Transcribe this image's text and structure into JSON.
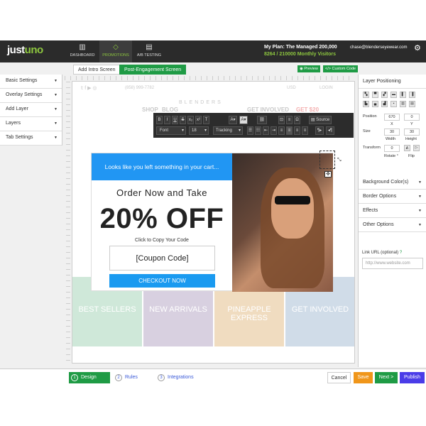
{
  "brand": {
    "logo_prefix": "just",
    "logo_suffix": "uno"
  },
  "nav": [
    {
      "label": "DASHBOARD",
      "icon": "bar-chart-icon"
    },
    {
      "label": "PROMOTIONS",
      "icon": "tag-icon"
    },
    {
      "label": "A/B TESTING",
      "icon": "ab-icon"
    }
  ],
  "plan": {
    "title": "My Plan: The Managed 200,000",
    "sub": "8264 / 210000 Monthly Visitors"
  },
  "user": {
    "email": "chase@blenderseyewear.com"
  },
  "left_menu": [
    "Basic Settings",
    "Overlay Settings",
    "Add Layer",
    "Layers",
    "Tab Settings"
  ],
  "tabs": [
    "Add Intro Screen",
    "Post-Engagement Screen"
  ],
  "canvas_buttons": {
    "preview": "Preview",
    "custom_code": "</> Custom Code"
  },
  "site": {
    "phone": "(858) 999-7782",
    "brand": "BLENDERS",
    "usd": "USD",
    "login": "LOGIN",
    "shop": "SHOP",
    "blog": "BLOG",
    "get_involved": "GET INVOLVED",
    "get_price": "GET $20",
    "tiles": [
      "BEST SELLERS",
      "NEW ARRIVALS",
      "PINEAPPLE EXPRESS",
      "GET INVOLVED"
    ]
  },
  "toolbar": {
    "source": "Source",
    "font": "Font",
    "size": "18",
    "tracking": "Tracking"
  },
  "popup": {
    "banner": "Looks like you left something in your cart...",
    "heading": "Order Now and Take",
    "discount": "20% OFF",
    "copy_hint": "Click to Copy Your Code",
    "coupon": "[Coupon Code]",
    "cta": "CHECKOUT NOW"
  },
  "right_panel": {
    "title": "Layer Positioning",
    "position": "Position",
    "x_val": "670",
    "y_val": "0",
    "x": "X",
    "y": "Y",
    "size": "Size",
    "w_val": "30",
    "h_val": "30",
    "width": "Width",
    "height": "Height",
    "transform": "Transform",
    "rotate_val": "0",
    "rotate": "Rotate °",
    "flip": "Flip",
    "sections": [
      "Background Color(s)",
      "Border Options",
      "Effects",
      "Other Options"
    ],
    "link_label": "Link URL (optional)",
    "link_placeholder": "http://www.website.com"
  },
  "steps": [
    {
      "n": "1",
      "label": "Design"
    },
    {
      "n": "2",
      "label": "Rules"
    },
    {
      "n": "3",
      "label": "Integrations"
    }
  ],
  "bottom_buttons": {
    "cancel": "Cancel",
    "save": "Save",
    "next": "Next >",
    "publish": "Publish"
  },
  "colors": {
    "green": "#1f9b45",
    "blue": "#2196f3",
    "dark": "#2b2b2b",
    "orange": "#f0961a",
    "purple": "#4a3ce8"
  }
}
